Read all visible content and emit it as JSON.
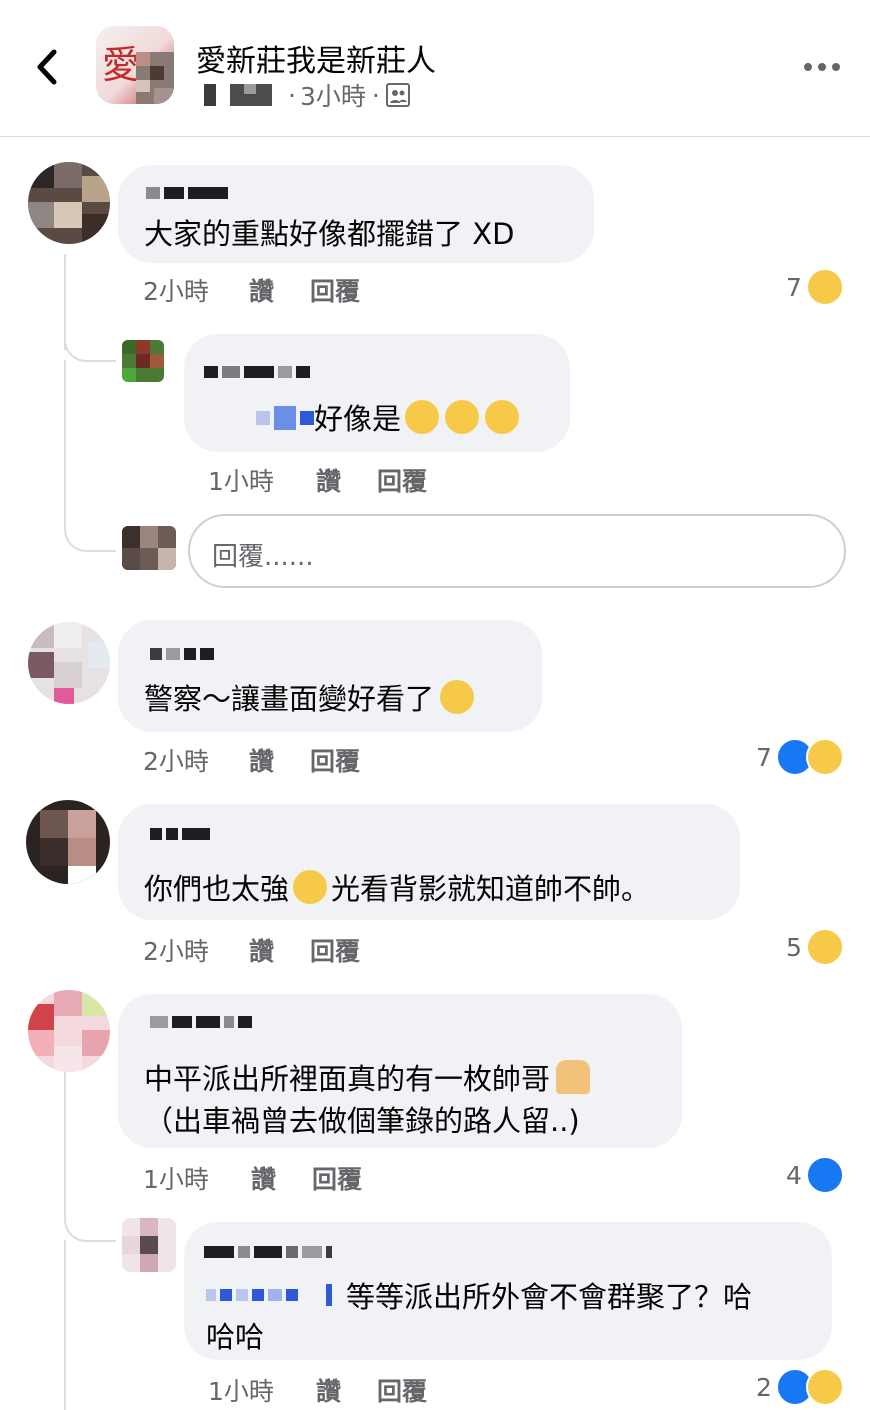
{
  "header": {
    "group_name": "愛新莊我是新莊人",
    "group_avatar_char": "愛",
    "time": "3小時",
    "separator": "·",
    "back_icon": "chevron-left-icon",
    "more_icon": "more-horizontal-icon",
    "audience_icon": "group-audience-icon"
  },
  "actions": {
    "like": "讚",
    "reply": "回覆"
  },
  "comments": [
    {
      "text": "大家的重點好像都擺錯了  XD",
      "time": "2小時",
      "reaction_count": "7",
      "reactions": [
        "haha-icon"
      ]
    },
    {
      "reply": true,
      "text": "好像是",
      "emoji": [
        "rolling-laughing-emoji",
        "rolling-laughing-emoji",
        "rolling-laughing-emoji"
      ],
      "time": "1小時"
    },
    {
      "text": "警察～讓畫面變好看了",
      "emoji": [
        "sweat-smile-emoji"
      ],
      "time": "2小時",
      "reaction_count": "7",
      "reactions": [
        "like-icon",
        "haha-icon"
      ]
    },
    {
      "text_before": "你們也太強",
      "emoji": [
        "flushed-face-emoji"
      ],
      "text_after": "光看背影就知道帥不帥。",
      "time": "2小時",
      "reaction_count": "5",
      "reactions": [
        "haha-icon"
      ]
    },
    {
      "line1": "中平派出所裡面真的有一枚帥哥",
      "emoji": [
        "man-in-tuxedo-emoji"
      ],
      "line2": "（出車禍曾去做個筆錄的路人留..)",
      "time": "1小時",
      "reaction_count": "4",
      "reactions": [
        "like-icon"
      ]
    },
    {
      "reply": true,
      "line1": "等等派出所外會不會群聚了？哈",
      "line2": "哈哈",
      "time": "1小時",
      "reaction_count": "2",
      "reactions": [
        "like-icon",
        "haha-icon"
      ]
    }
  ],
  "reply_input": {
    "placeholder": "回覆......"
  },
  "colors": {
    "bubble": "#f0f2f5",
    "meta_text": "#65676b",
    "like_blue": "#1877f2",
    "emoji_yellow": "#f7c948"
  }
}
